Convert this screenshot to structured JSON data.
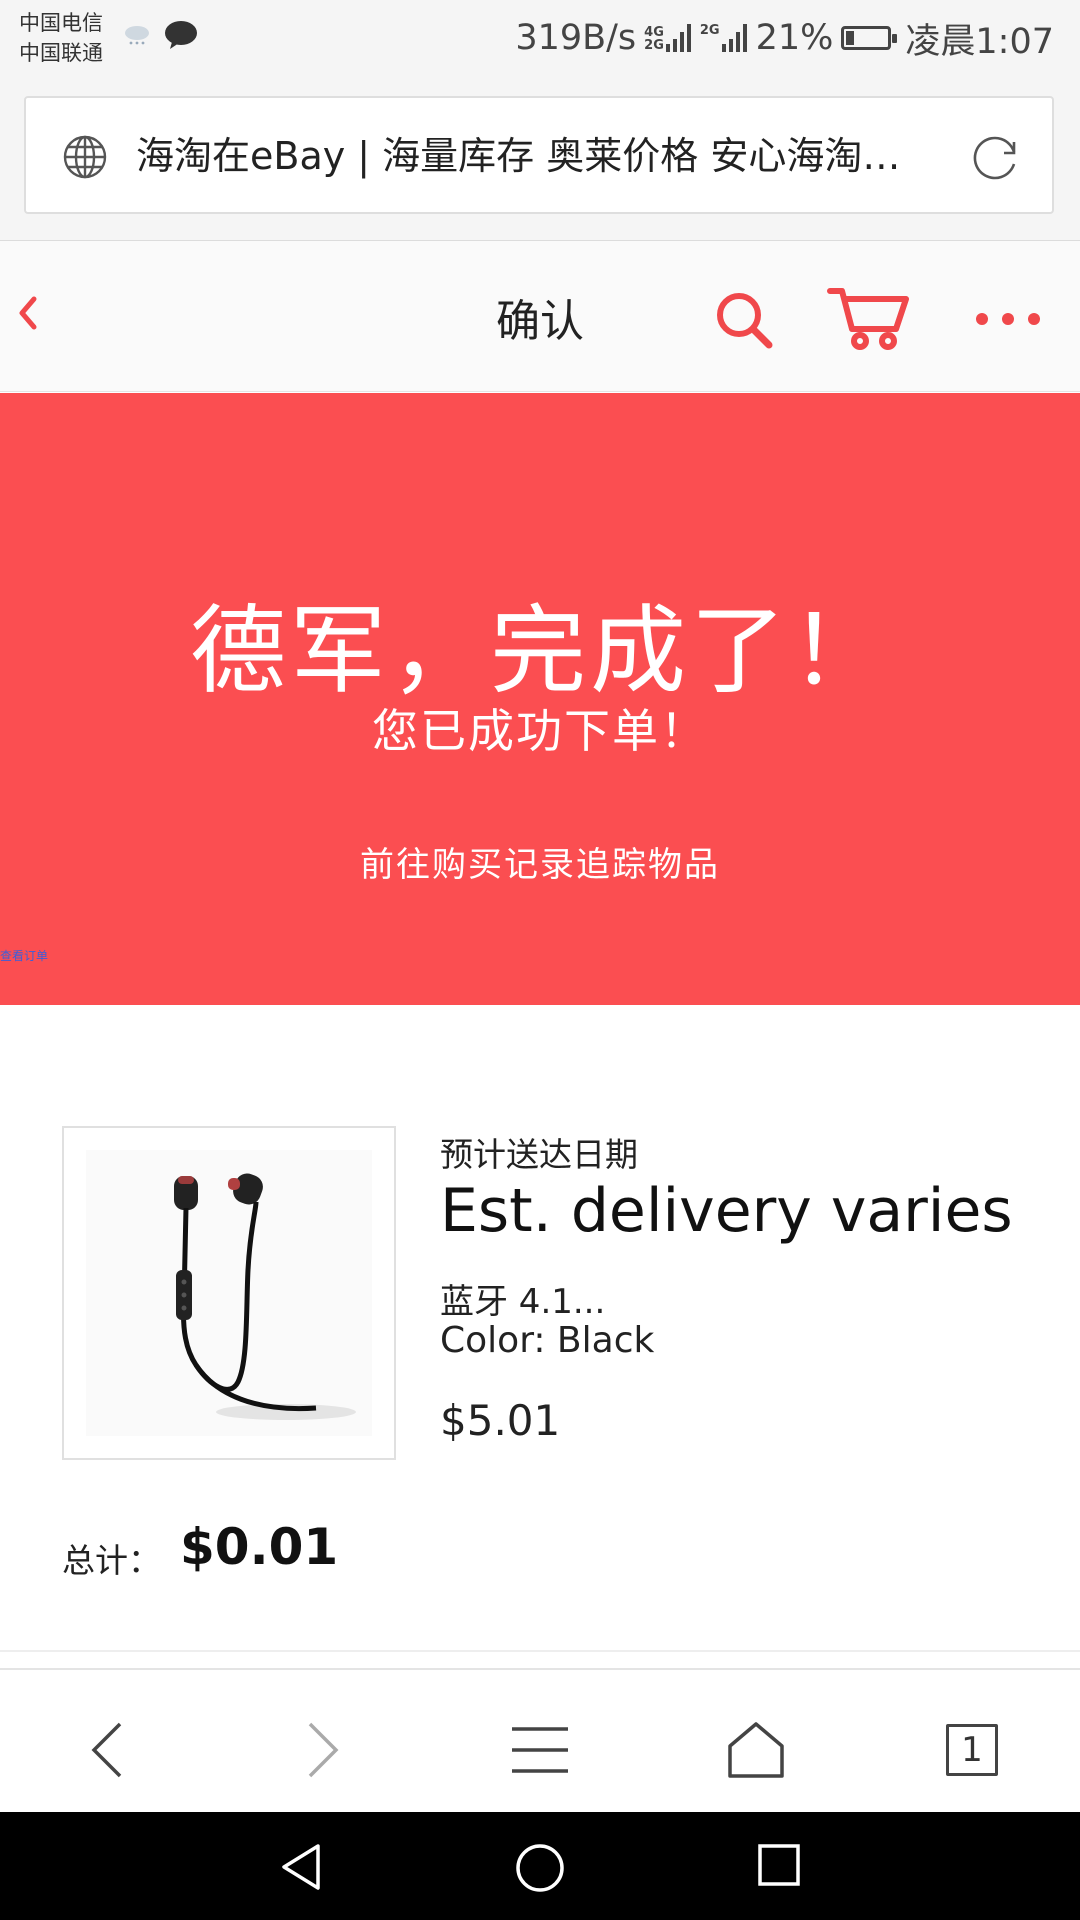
{
  "status_bar": {
    "carrier_1": "中国电信",
    "carrier_2": "中国联通",
    "net_speed": "319B/s",
    "sig1_top": "4G",
    "sig1_bottom": "2G",
    "sig2": "2G",
    "battery_percent": "21%",
    "battery_level": 0.21,
    "time": "凌晨1:07",
    "weather_icon": "cloud-rain-icon",
    "notification_icon": "chat-bubble-icon"
  },
  "address_bar": {
    "title": "海淘在eBay | 海量库存 奥莱价格 安心海淘…"
  },
  "header": {
    "title": "确认"
  },
  "banner": {
    "heading": "德军，完成了！",
    "subheading": "您已成功下单！",
    "link": "前往购买记录追踪物品",
    "tiny_text": "查看订单"
  },
  "order": {
    "delivery_label": "预计送达日期",
    "delivery_value": "Est. delivery varies",
    "item_title": "蓝牙 4.1...",
    "item_variant": "Color: Black",
    "item_price": "$5.01",
    "total_label": "总计：",
    "total_value": "$0.01"
  },
  "browser_nav": {
    "tab_count": "1"
  },
  "colors": {
    "brand_red": "#fb4e51",
    "icon_red": "#f0484b"
  }
}
